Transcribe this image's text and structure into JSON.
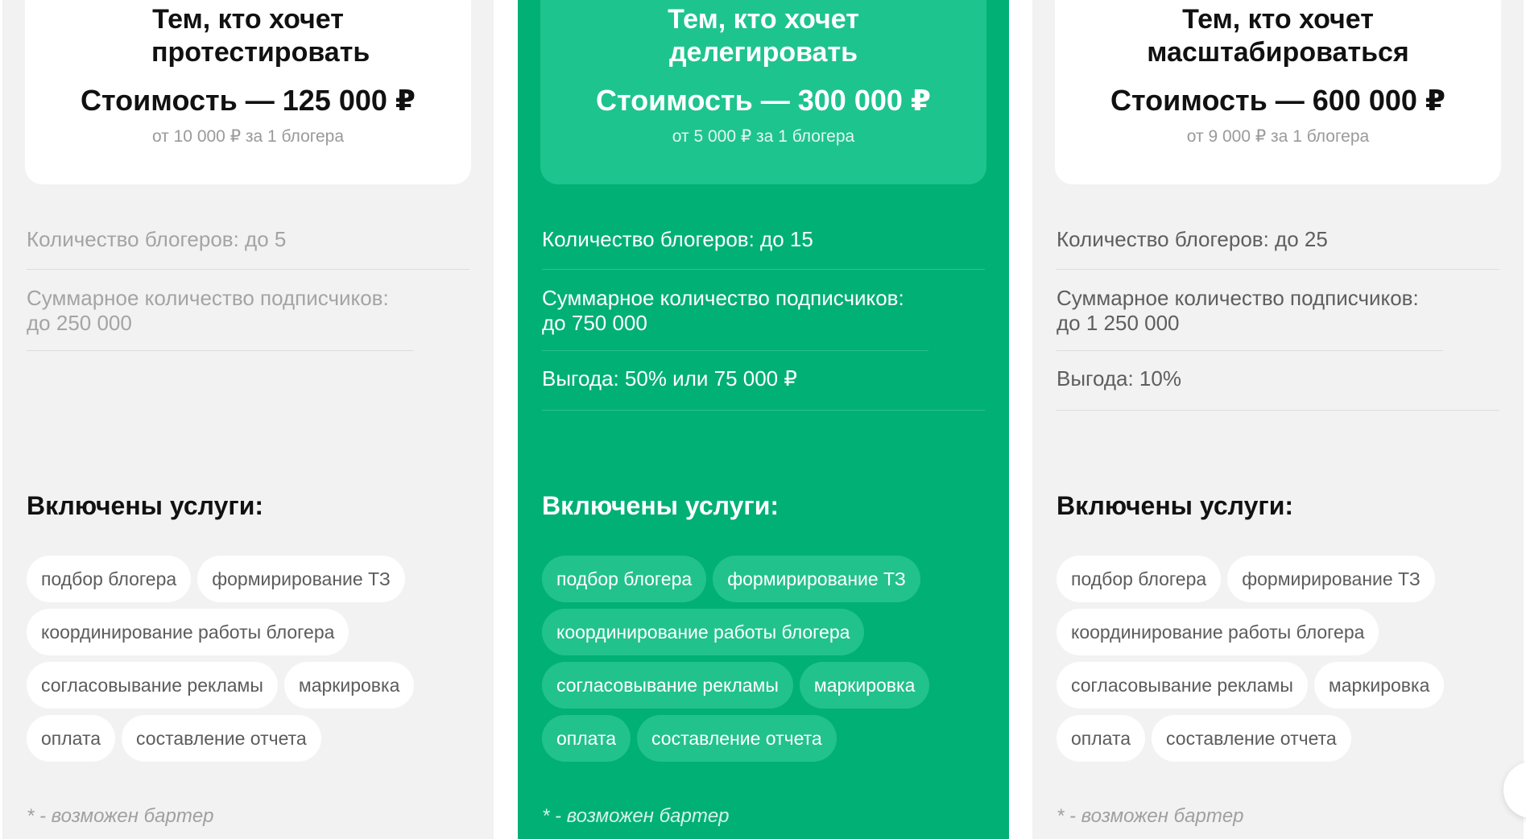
{
  "plans": [
    {
      "title": "Тем, кто хочет протестировать",
      "price": "Стоимость — 125 000 ₽",
      "per_blogger": "от 10 000 ₽ за 1 блогера",
      "features": [
        "Количество блогеров: до 5",
        "Суммарное количество подписчиков: до 250 000"
      ],
      "services_title": "Включены услуги:",
      "services": [
        "подбор блогера",
        "формирирование ТЗ",
        "координирование работы блогера",
        "согласовывание рекламы",
        "маркировка",
        "оплата",
        "составление отчета"
      ],
      "note": "* - возможен бартер"
    },
    {
      "title": "Тем, кто хочет делегировать",
      "price": "Стоимость — 300 000 ₽",
      "per_blogger": "от 5 000 ₽ за 1 блогера",
      "features": [
        "Количество блогеров: до 15",
        "Суммарное количество подписчиков: до 750 000",
        "Выгода: 50% или 75 000 ₽"
      ],
      "services_title": "Включены услуги:",
      "services": [
        "подбор блогера",
        "формирирование ТЗ",
        "координирование работы блогера",
        "согласовывание рекламы",
        "маркировка",
        "оплата",
        "составление отчета"
      ],
      "note": "* - возможен бартер"
    },
    {
      "title": "Тем, кто хочет масштабироваться",
      "price": "Стоимость — 600 000 ₽",
      "per_blogger": "от 9 000 ₽ за 1 блогера",
      "features": [
        "Количество блогеров: до 25",
        "Суммарное количество подписчиков: до 1 250 000",
        "Выгода: 10%"
      ],
      "services_title": "Включены услуги:",
      "services": [
        "подбор блогера",
        "формирирование ТЗ",
        "координирование работы блогера",
        "согласовывание рекламы",
        "маркировка",
        "оплата",
        "составление отчета"
      ],
      "note": "* - возможен бартер"
    }
  ],
  "colors": {
    "accent_green": "#00b075",
    "card_gray": "#f2f2f2"
  }
}
